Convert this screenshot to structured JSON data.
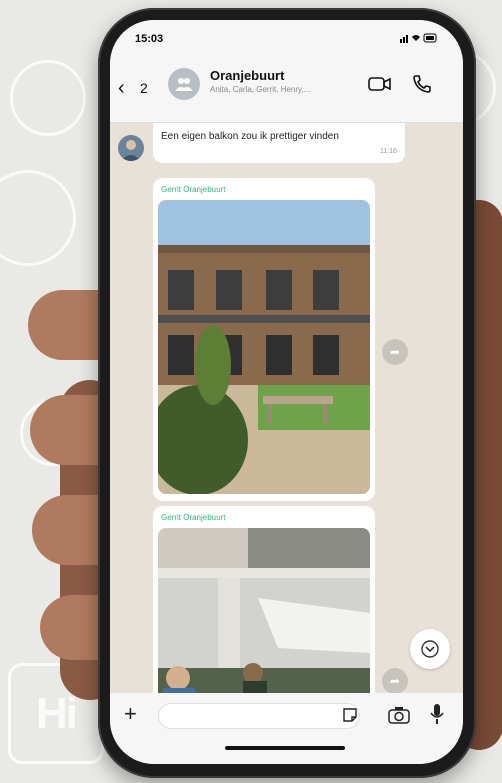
{
  "status": {
    "time": "15:03",
    "icons": "signal, wifi, battery"
  },
  "chat_header": {
    "back_count": "2",
    "title": "Oranjebuurt",
    "subtitle": "Anita, Carla, Gerrit, Henry,..."
  },
  "messages": [
    {
      "type": "text",
      "text": "Een eigen balkon zou ik prettiger vinden",
      "time": "11:16"
    },
    {
      "type": "image",
      "sender": "Gerrit Oranjebuurt"
    },
    {
      "type": "image",
      "sender": "Gerrit Oranjebuurt"
    }
  ],
  "colors": {
    "accent": "#2eb67d",
    "chat_background": "#e8e1d8"
  },
  "background_badge": "Hi"
}
